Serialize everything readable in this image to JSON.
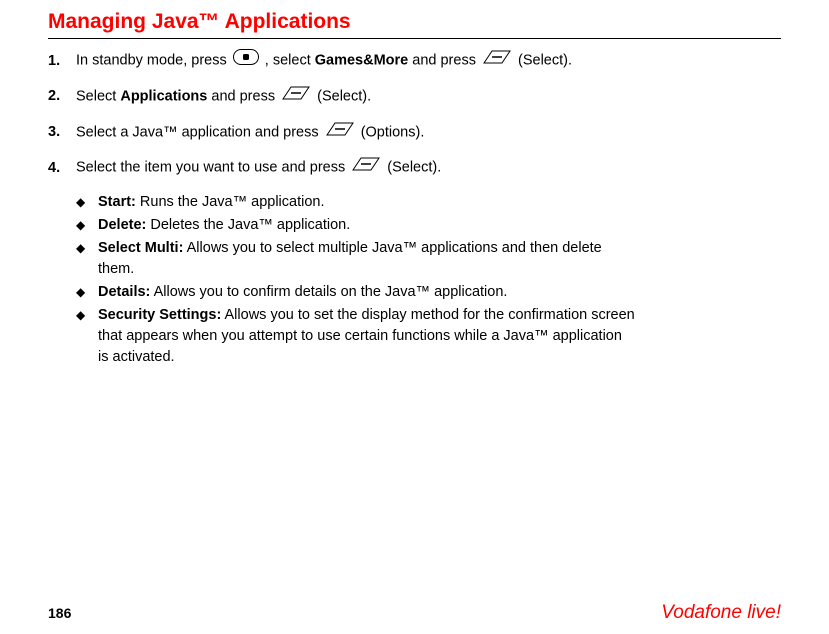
{
  "title": "Managing Java™ Applications",
  "steps": [
    {
      "num": "1.",
      "pre": "In standby mode, press ",
      "key1": "center",
      "mid1": ", select ",
      "bold1": "Games&More",
      "mid2": " and press ",
      "key2": "softkey",
      "post": " (Select)."
    },
    {
      "num": "2.",
      "pre": "Select ",
      "bold1": "Applications",
      "mid1": " and press ",
      "key1": "softkey",
      "post": " (Select)."
    },
    {
      "num": "3.",
      "pre": "Select a Java™ application and press ",
      "key1": "softkey",
      "post": " (Options)."
    },
    {
      "num": "4.",
      "pre": "Select the item you want to use and press ",
      "key1": "softkey",
      "post": " (Select)."
    }
  ],
  "bullets": [
    {
      "label": "Start:",
      "text": " Runs the Java™ application."
    },
    {
      "label": "Delete:",
      "text": " Deletes the Java™ application."
    },
    {
      "label": "Select Multi:",
      "text": " Allows you to select multiple Java™ applications and then delete them."
    },
    {
      "label": "Details:",
      "text": " Allows you to confirm details on the Java™ application."
    },
    {
      "label": "Security Settings:",
      "text": " Allows you to set the display method for the confirmation screen that appears when you attempt to use certain functions while a Java™ application is activated."
    }
  ],
  "footer": {
    "pagenum": "186",
    "brand": "Vodafone live!"
  }
}
